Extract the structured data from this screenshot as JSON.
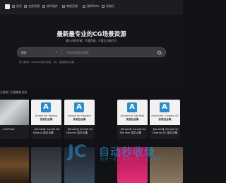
{
  "nav": {
    "items": [
      {
        "label": "首页"
      },
      {
        "label": "全部资源"
      },
      {
        "label": "软件插件"
      },
      {
        "label": "教程资源"
      },
      {
        "label": "我的Beta"
      },
      {
        "label": "导航栏"
      }
    ]
  },
  "hero": {
    "title": "最新最专业的CG场景资源",
    "subtitle": "输入你的关键，不要犹豫，不要忘记备注号",
    "search_category": "搜索",
    "search_placeholder": "找到所需要的资源",
    "hot_text": "热门推荐：blender插件合集，3D，渲染插件合集"
  },
  "section": {
    "title": "当前热门主题最新资源"
  },
  "cards": [
    {
      "product": "Arnold for Katana",
      "badge": "安装包合集",
      "title": "【Arnold】Arnold for Katana 插件合集"
    },
    {
      "product": "Arnold for Houdini",
      "badge": "安装包合集",
      "title": "【Arnold】Arnold for Houdini 插件合集"
    },
    {
      "product": "Arnold for 3ds Max",
      "badge": "安装包合集",
      "title": "【Arnold】Arnold for 3ds Max 插件合集"
    },
    {
      "product": "Arnold for Cinema 4D",
      "badge": "安装包合集",
      "title": "【Arnold】Arnold for Cinema 4D 插件合集"
    }
  ],
  "left_partial": {
    "title": "...ProPlant"
  },
  "right_partial": {
    "title": "【Ar..."
  },
  "watermark": {
    "main": "自动秒收录",
    "sub": "收录一站 · 来访一次 · 自动收录"
  }
}
